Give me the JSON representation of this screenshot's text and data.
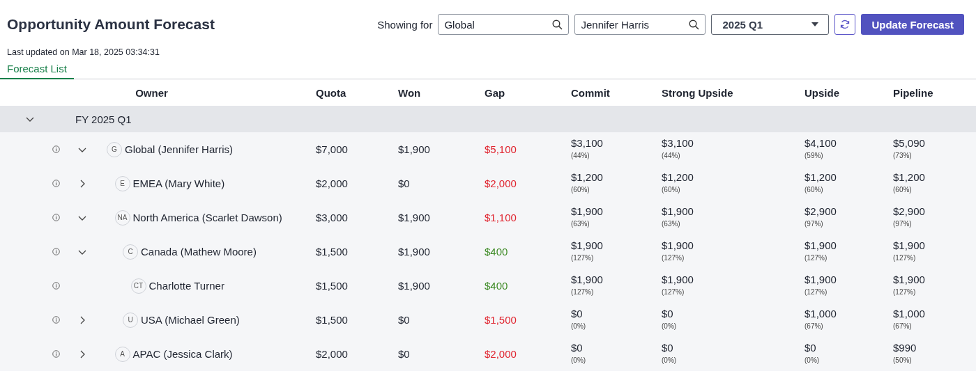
{
  "title": "Opportunity Amount Forecast",
  "filters": {
    "label": "Showing for",
    "territory": {
      "value": "Global"
    },
    "owner": {
      "value": "Jennifer Harris"
    },
    "period": {
      "value": "2025 Q1"
    },
    "action": "Update Forecast"
  },
  "last_updated": "Last updated on Mar 18, 2025 03:34:31",
  "tabs": [
    {
      "label": "Forecast List",
      "selected": true
    }
  ],
  "table": {
    "columns": [
      "Owner",
      "Quota",
      "Won",
      "Gap",
      "Commit",
      "Strong Upside",
      "Upside",
      "Pipeline"
    ],
    "group": {
      "label": "FY 2025 Q1",
      "expanded": true
    },
    "rows": [
      {
        "initials": "G",
        "owner": "Global (Jennifer Harris)",
        "expanded": true,
        "quota": "$7,000",
        "won": "$1,900",
        "gap": {
          "value": "$5,100",
          "kind": "short"
        },
        "commit": {
          "amount": "$3,100",
          "share": "(44%)"
        },
        "strong_upside": {
          "amount": "$3,100",
          "share": "(44%)"
        },
        "upside": {
          "amount": "$4,100",
          "share": "(59%)"
        },
        "pipeline": {
          "amount": "$5,090",
          "share": "(73%)"
        },
        "children": [
          {
            "initials": "E",
            "owner": "EMEA (Mary White)",
            "expanded": false,
            "quota": "$2,000",
            "won": "$0",
            "gap": {
              "value": "$2,000",
              "kind": "short"
            },
            "commit": {
              "amount": "$1,200",
              "share": "(60%)"
            },
            "strong_upside": {
              "amount": "$1,200",
              "share": "(60%)"
            },
            "upside": {
              "amount": "$1,200",
              "share": "(60%)"
            },
            "pipeline": {
              "amount": "$1,200",
              "share": "(60%)"
            }
          },
          {
            "initials": "NA",
            "owner": "North America (Scarlet Dawson)",
            "expanded": true,
            "quota": "$3,000",
            "won": "$1,900",
            "gap": {
              "value": "$1,100",
              "kind": "short"
            },
            "commit": {
              "amount": "$1,900",
              "share": "(63%)"
            },
            "strong_upside": {
              "amount": "$1,900",
              "share": "(63%)"
            },
            "upside": {
              "amount": "$2,900",
              "share": "(97%)"
            },
            "pipeline": {
              "amount": "$2,900",
              "share": "(97%)"
            },
            "children": [
              {
                "initials": "C",
                "owner": "Canada (Mathew Moore)",
                "expanded": true,
                "quota": "$1,500",
                "won": "$1,900",
                "gap": {
                  "value": "$400",
                  "kind": "over"
                },
                "commit": {
                  "amount": "$1,900",
                  "share": "(127%)"
                },
                "strong_upside": {
                  "amount": "$1,900",
                  "share": "(127%)"
                },
                "upside": {
                  "amount": "$1,900",
                  "share": "(127%)"
                },
                "pipeline": {
                  "amount": "$1,900",
                  "share": "(127%)"
                },
                "children": [
                  {
                    "initials": "CT",
                    "owner": "Charlotte Turner",
                    "quota": "$1,500",
                    "won": "$1,900",
                    "gap": {
                      "value": "$400",
                      "kind": "over"
                    },
                    "commit": {
                      "amount": "$1,900",
                      "share": "(127%)"
                    },
                    "strong_upside": {
                      "amount": "$1,900",
                      "share": "(127%)"
                    },
                    "upside": {
                      "amount": "$1,900",
                      "share": "(127%)"
                    },
                    "pipeline": {
                      "amount": "$1,900",
                      "share": "(127%)"
                    }
                  }
                ]
              },
              {
                "initials": "U",
                "owner": "USA (Michael Green)",
                "expanded": false,
                "quota": "$1,500",
                "won": "$0",
                "gap": {
                  "value": "$1,500",
                  "kind": "short"
                },
                "commit": {
                  "amount": "$0",
                  "share": "(0%)"
                },
                "strong_upside": {
                  "amount": "$0",
                  "share": "(0%)"
                },
                "upside": {
                  "amount": "$1,000",
                  "share": "(67%)"
                },
                "pipeline": {
                  "amount": "$1,000",
                  "share": "(67%)"
                }
              }
            ]
          },
          {
            "initials": "A",
            "owner": "APAC (Jessica Clark)",
            "expanded": false,
            "quota": "$2,000",
            "won": "$0",
            "gap": {
              "value": "$2,000",
              "kind": "short"
            },
            "commit": {
              "amount": "$0",
              "share": "(0%)"
            },
            "strong_upside": {
              "amount": "$0",
              "share": "(0%)"
            },
            "upside": {
              "amount": "$0",
              "share": "(0%)"
            },
            "pipeline": {
              "amount": "$990",
              "share": "(50%)"
            }
          }
        ]
      }
    ]
  }
}
